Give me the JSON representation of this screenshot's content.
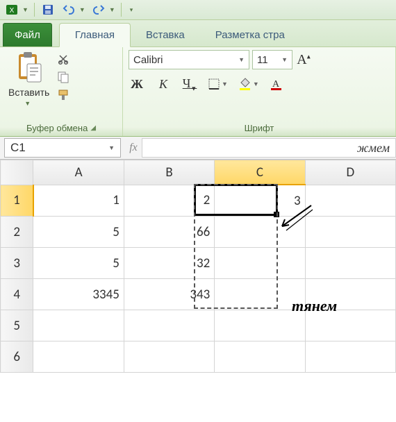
{
  "qat": {
    "excel_icon": "excel-icon",
    "save_icon": "save-icon",
    "undo_icon": "undo-icon",
    "redo_icon": "redo-icon"
  },
  "tabs": {
    "file": "Файл",
    "items": [
      "Главная",
      "Вставка",
      "Разметка стра"
    ],
    "active_index": 0
  },
  "ribbon": {
    "clipboard": {
      "paste": "Вставить",
      "label": "Буфер обмена"
    },
    "font": {
      "name": "Calibri",
      "size": "11",
      "bold": "Ж",
      "italic": "К",
      "underline": "Ч",
      "label": "Шрифт"
    }
  },
  "namebox": "C1",
  "formula_hint": "жмем",
  "grid": {
    "cols": [
      "A",
      "B",
      "C",
      "D"
    ],
    "rows": [
      "1",
      "2",
      "3",
      "4",
      "5",
      "6"
    ],
    "cells": {
      "A1": "1",
      "B1": "2",
      "C1": "3",
      "A2": "5",
      "B2": "66",
      "A3": "5",
      "B3": "32",
      "A4": "3345",
      "B4": "343"
    },
    "selected_col": "C",
    "selected_row": "1"
  },
  "annotation2": "тянем"
}
